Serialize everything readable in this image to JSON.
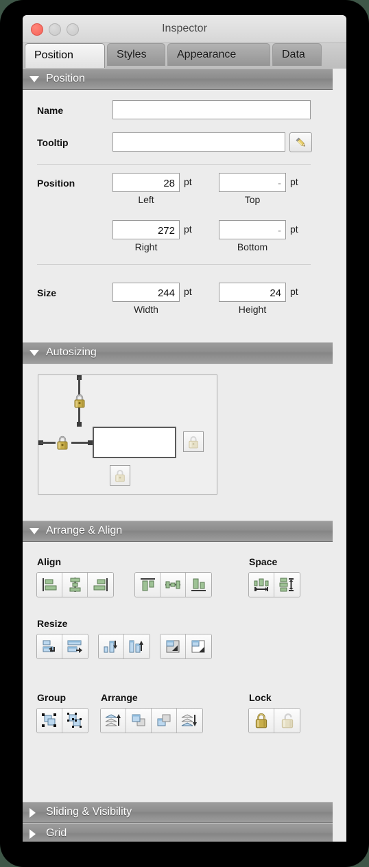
{
  "window": {
    "title": "Inspector",
    "traffic_lights": [
      "close-button",
      "minimize-button",
      "zoom-button"
    ]
  },
  "tabs": [
    {
      "label": "Position",
      "active": true
    },
    {
      "label": "Styles",
      "active": false
    },
    {
      "label": "Appearance",
      "active": false
    },
    {
      "label": "Data",
      "active": false
    }
  ],
  "sections": {
    "position": {
      "title": "Position",
      "expanded": true,
      "name_label": "Name",
      "name_value": "",
      "name_placeholder": "",
      "tooltip_label": "Tooltip",
      "tooltip_value": "",
      "tooltip_placeholder": "",
      "edit_button_icon": "pencil-icon",
      "position_label": "Position",
      "left_value": "28",
      "left_caption": "Left",
      "top_value": "-",
      "top_caption": "Top",
      "right_value": "272",
      "right_caption": "Right",
      "bottom_value": "-",
      "bottom_caption": "Bottom",
      "size_label": "Size",
      "width_value": "244",
      "width_caption": "Width",
      "height_value": "24",
      "height_caption": "Height",
      "unit": "pt"
    },
    "autosizing": {
      "title": "Autosizing",
      "expanded": true,
      "top_lock": "locked",
      "left_lock": "locked",
      "right_lock": "unlocked",
      "bottom_lock": "unlocked"
    },
    "arrange_align": {
      "title": "Arrange & Align",
      "expanded": true,
      "align_label": "Align",
      "align_buttons": [
        "align-left-icon",
        "align-center-horizontal-icon",
        "align-right-icon",
        "align-top-icon",
        "align-center-vertical-icon",
        "align-bottom-icon"
      ],
      "space_label": "Space",
      "space_buttons": [
        "distribute-horizontal-icon",
        "distribute-vertical-icon"
      ],
      "resize_label": "Resize",
      "resize_buttons": [
        "resize-width-smallest-icon",
        "resize-width-largest-icon",
        "resize-height-smallest-icon",
        "resize-height-largest-icon",
        "resize-both-smallest-icon",
        "resize-both-largest-icon"
      ],
      "group_label": "Group",
      "group_buttons": [
        "group-icon",
        "ungroup-icon"
      ],
      "arrange_label": "Arrange",
      "arrange_buttons": [
        "bring-to-front-icon",
        "bring-forward-icon",
        "send-backward-icon",
        "send-to-back-icon"
      ],
      "lock_label": "Lock",
      "lock_buttons": [
        "lock-icon",
        "unlock-icon"
      ]
    },
    "sliding_visibility": {
      "title": "Sliding & Visibility",
      "expanded": false
    },
    "grid": {
      "title": "Grid",
      "expanded": false
    }
  },
  "colors": {
    "window_bg": "#ececec",
    "section_header": "#8d8d8d",
    "align_icon_green": "#8fb587",
    "resize_icon_blue": "#a9cbe8",
    "lock_gold": "#c8ae4a",
    "close_red": "#f5635a"
  }
}
